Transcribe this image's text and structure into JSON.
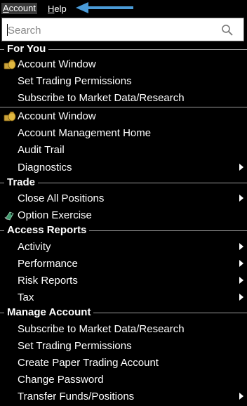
{
  "menubar": {
    "account": "Account",
    "help": "Help"
  },
  "search": {
    "placeholder": "Search"
  },
  "sections": {
    "for_you": "For You",
    "trade": "Trade",
    "access_reports": "Access Reports",
    "manage_account": "Manage Account"
  },
  "items": {
    "account_window_1": "Account Window",
    "set_trading_permissions_1": "Set Trading Permissions",
    "subscribe_market_data_1": "Subscribe to Market Data/Research",
    "account_window_2": "Account Window",
    "account_management_home": "Account Management Home",
    "audit_trail": "Audit Trail",
    "diagnostics": "Diagnostics",
    "close_all_positions": "Close All Positions",
    "option_exercise": "Option Exercise",
    "activity": "Activity",
    "performance": "Performance",
    "risk_reports": "Risk Reports",
    "tax": "Tax",
    "subscribe_market_data_2": "Subscribe to Market Data/Research",
    "set_trading_permissions_2": "Set Trading Permissions",
    "create_paper_trading_account": "Create Paper Trading Account",
    "change_password": "Change Password",
    "transfer_funds_positions": "Transfer Funds/Positions"
  },
  "colors": {
    "background": "#000000",
    "text": "#ffffff",
    "arrow": "#4a9bd8",
    "divider": "#9a9a9a"
  },
  "icons": {
    "account": "money-bag-icon",
    "option": "tag-icon",
    "submenu": "triangle-right-icon",
    "search": "magnifier-icon"
  }
}
